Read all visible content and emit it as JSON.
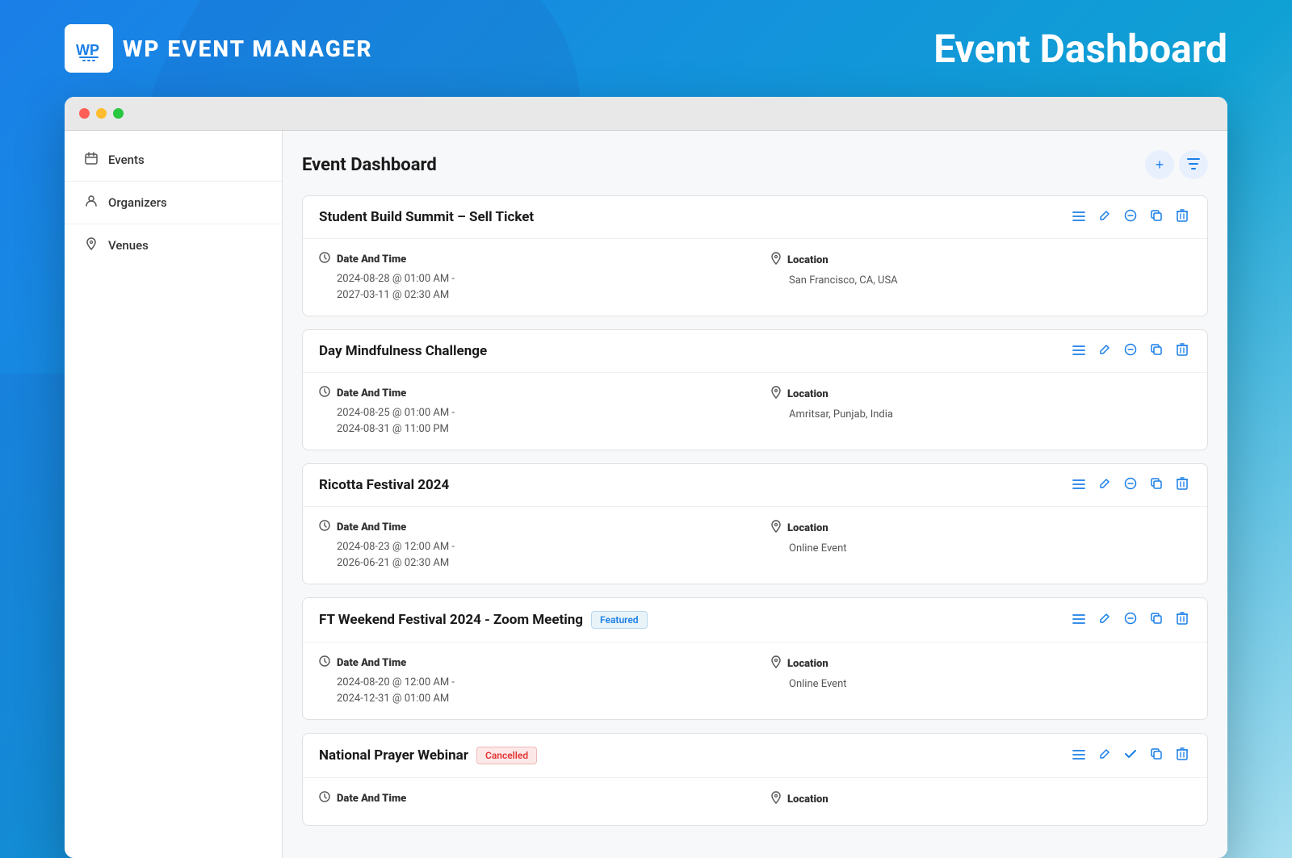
{
  "app": {
    "logo_text": "WP EVENT MANAGER",
    "header_title": "Event Dashboard"
  },
  "window": {
    "title_bar": {
      "btn_red": "close",
      "btn_yellow": "minimize",
      "btn_green": "maximize"
    }
  },
  "sidebar": {
    "items": [
      {
        "id": "events",
        "label": "Events",
        "icon": "calendar"
      },
      {
        "id": "organizers",
        "label": "Organizers",
        "icon": "person"
      },
      {
        "id": "venues",
        "label": "Venues",
        "icon": "pin"
      }
    ]
  },
  "dashboard": {
    "title": "Event Dashboard",
    "add_label": "+",
    "filter_label": "⊞",
    "events": [
      {
        "id": "event-1",
        "title": "Student Build Summit – Sell Ticket",
        "badge": null,
        "date_label": "Date And Time",
        "date_value": "2024-08-28 @ 01:00 AM -\n2027-03-11 @ 02:30 AM",
        "location_label": "Location",
        "location_value": "San Francisco, CA, USA"
      },
      {
        "id": "event-2",
        "title": "Day Mindfulness Challenge",
        "badge": null,
        "date_label": "Date And Time",
        "date_value": "2024-08-25 @ 01:00 AM -\n2024-08-31 @ 11:00 PM",
        "location_label": "Location",
        "location_value": "Amritsar, Punjab, India"
      },
      {
        "id": "event-3",
        "title": "Ricotta Festival 2024",
        "badge": null,
        "date_label": "Date And Time",
        "date_value": "2024-08-23 @ 12:00 AM -\n2026-06-21 @ 02:30 AM",
        "location_label": "Location",
        "location_value": "Online Event"
      },
      {
        "id": "event-4",
        "title": "FT Weekend Festival 2024 - Zoom Meeting",
        "badge": "Featured",
        "badge_type": "featured",
        "date_label": "Date And Time",
        "date_value": "2024-08-20 @ 12:00 AM -\n2024-12-31 @ 01:00 AM",
        "location_label": "Location",
        "location_value": "Online Event"
      },
      {
        "id": "event-5",
        "title": "National Prayer Webinar",
        "badge": "Cancelled",
        "badge_type": "cancelled",
        "date_label": "Date And Time",
        "date_value": "",
        "location_label": "Location",
        "location_value": ""
      }
    ]
  }
}
